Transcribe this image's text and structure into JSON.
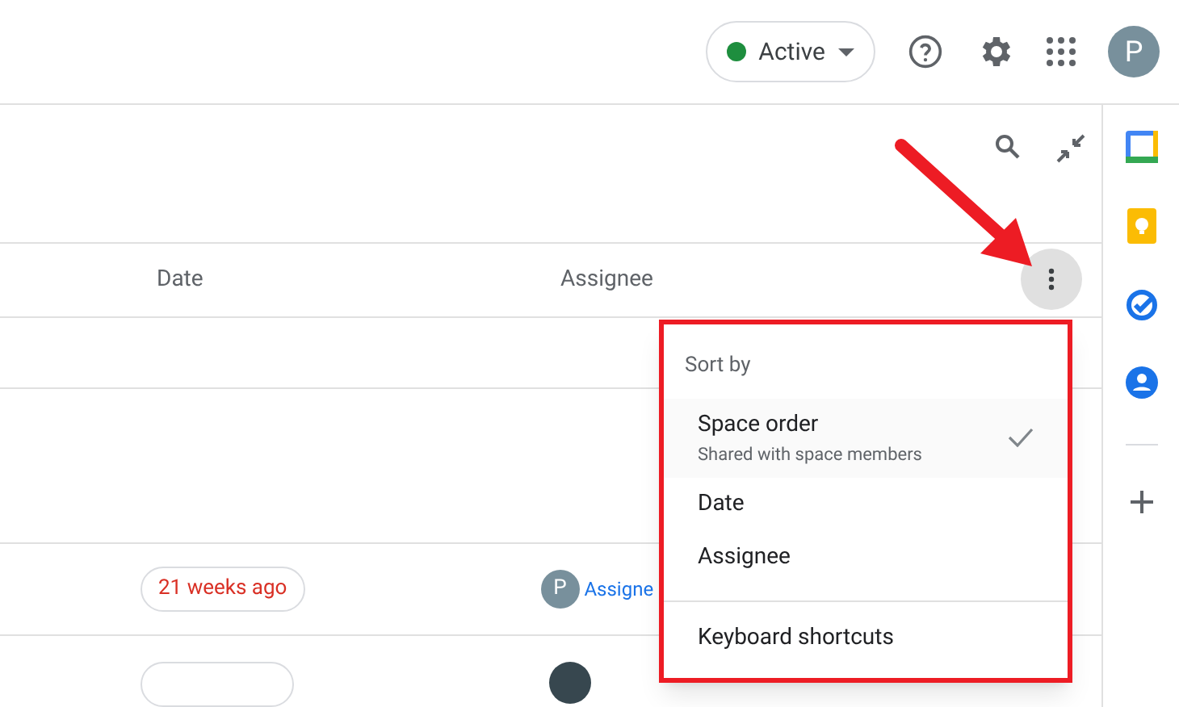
{
  "top_bar": {
    "status": {
      "label": "Active",
      "color": "#1e8e3e"
    },
    "avatar": "P"
  },
  "table": {
    "columns": [
      {
        "label": "Date"
      },
      {
        "label": "Assignee"
      }
    ],
    "rows": [
      {
        "date": "21 weeks ago",
        "assignee_initial": "P",
        "assignee": "Assigne"
      }
    ]
  },
  "menu": {
    "heading": "Sort by",
    "items": [
      {
        "label": "Space order",
        "subtitle": "Shared with space members",
        "selected": true
      },
      {
        "label": "Date",
        "selected": false
      },
      {
        "label": "Assignee",
        "selected": false
      }
    ],
    "footer_item": "Keyboard shortcuts"
  }
}
